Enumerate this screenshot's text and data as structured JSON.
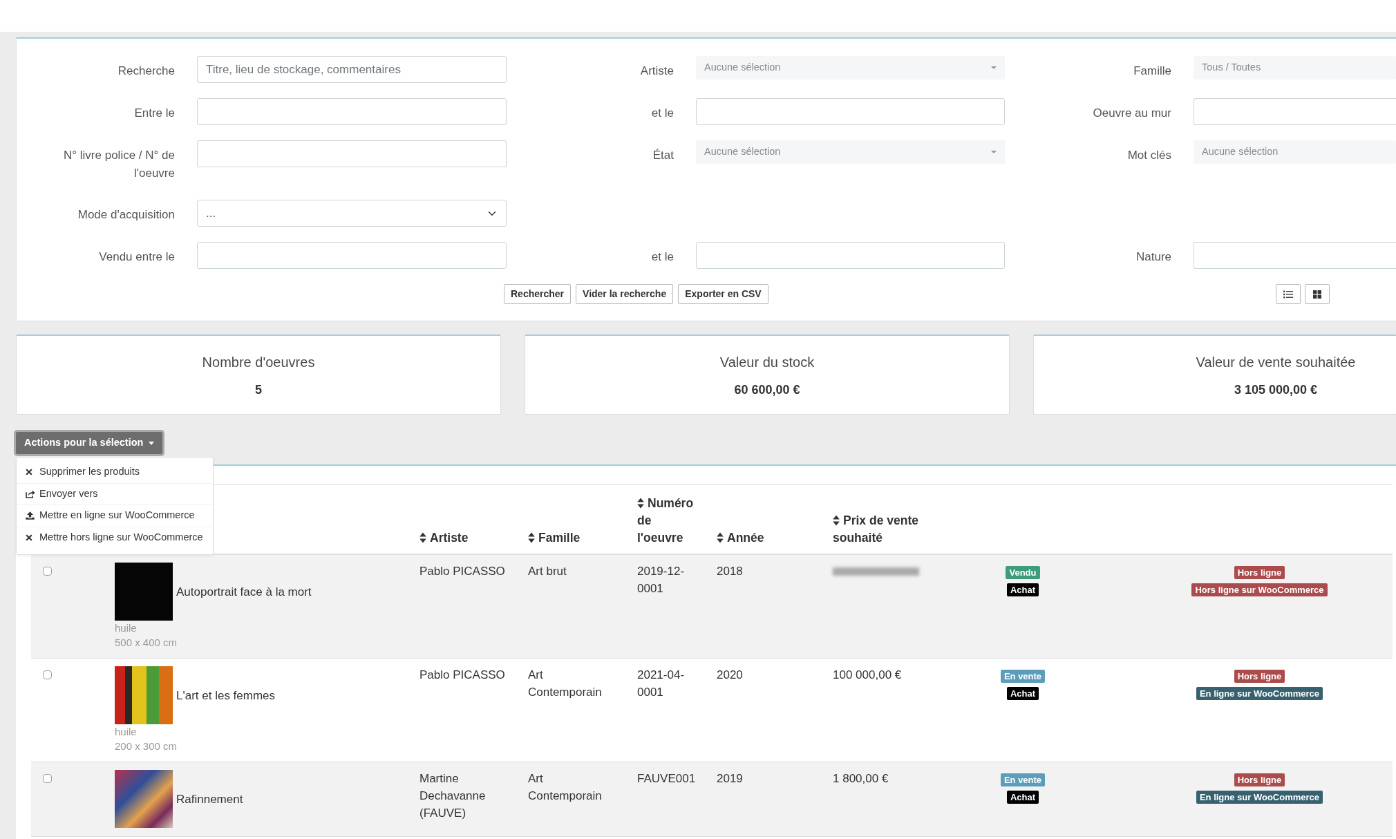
{
  "filters": {
    "rows": [
      [
        {
          "label": "Recherche",
          "kind": "text",
          "placeholder": "Titre, lieu de stockage, commentaires"
        },
        {
          "label": "Artiste",
          "kind": "select",
          "placeholder": "Aucune sélection",
          "caret": true
        },
        {
          "label": "Famille",
          "kind": "select",
          "placeholder": "Tous / Toutes",
          "caret": false
        }
      ],
      [
        {
          "label": "Entre le",
          "kind": "text"
        },
        {
          "label": "et le",
          "kind": "text"
        },
        {
          "label": "Oeuvre au mur",
          "kind": "text"
        }
      ],
      [
        {
          "label": "N° livre police / N° de l'oeuvre",
          "kind": "text"
        },
        {
          "label": "État",
          "kind": "select",
          "placeholder": "Aucune sélection",
          "caret": true
        },
        {
          "label": "Mot clés",
          "kind": "select",
          "placeholder": "Aucune sélection",
          "caret": false
        }
      ],
      [
        {
          "label": "Mode d'acquisition",
          "kind": "dropdown",
          "value": "..."
        },
        null,
        null
      ],
      [
        {
          "label": "Vendu entre le",
          "kind": "text"
        },
        {
          "label": "et le",
          "kind": "text"
        },
        {
          "label": "Nature",
          "kind": "text"
        }
      ]
    ],
    "buttons": [
      "Rechercher",
      "Vider la recherche",
      "Exporter en CSV"
    ],
    "view_buttons": [
      {
        "kind": "list"
      },
      {
        "kind": "grid"
      }
    ]
  },
  "stats": [
    {
      "title": "Nombre d'oeuvres",
      "value": "5"
    },
    {
      "title": "Valeur du stock",
      "value": "60 600,00 €"
    },
    {
      "title": "Valeur de vente souhaitée",
      "value": "3 105 000,00 €"
    }
  ],
  "actions": {
    "label": "Actions pour la sélection",
    "expanded": true,
    "items": [
      {
        "label": "Supprimer les produits",
        "kind": "delete"
      },
      {
        "label": "Envoyer vers",
        "kind": "send"
      },
      {
        "label": "Mettre en ligne sur WooCommerce",
        "kind": "publish"
      },
      {
        "label": "Mettre hors ligne sur WooCommerce",
        "kind": "delete"
      }
    ]
  },
  "table": {
    "columns": [
      {
        "label": "Artiste"
      },
      {
        "label": "Famille"
      },
      {
        "label": "Numéro de l'oeuvre"
      },
      {
        "label": "Année"
      },
      {
        "label": "Prix de vente souhaité"
      }
    ],
    "rows": [
      {
        "checked": false,
        "title": "Autoportrait face à la mort",
        "medium": "huile",
        "size": "500 x 400 cm",
        "artist": "Pablo PICASSO",
        "family": "Art brut",
        "number": "2019-12-0001",
        "year": "2018",
        "price_blurred": true,
        "status_badges": [
          {
            "label": "Vendu",
            "color": "#3d9b7e"
          },
          {
            "label": "Achat",
            "color": "#000000"
          }
        ],
        "shop_badges": [
          {
            "label": "Hors ligne",
            "color": "#ab4b4b"
          },
          {
            "label": "Hors ligne sur WooCommerce",
            "color": "#ab4b4b"
          }
        ]
      },
      {
        "checked": false,
        "title": "L'art et les femmes",
        "medium": "huile",
        "size": "200 x 300 cm",
        "artist": "Pablo PICASSO",
        "family": "Art Contemporain",
        "number": "2021-04-0001",
        "year": "2020",
        "price": "100 000,00 €",
        "price_blurred": false,
        "status_badges": [
          {
            "label": "En vente",
            "color": "#5b9dbb"
          },
          {
            "label": "Achat",
            "color": "#000000"
          }
        ],
        "shop_badges": [
          {
            "label": "Hors ligne",
            "color": "#ab4b4b"
          },
          {
            "label": "En ligne sur WooCommerce",
            "color": "#37616f"
          }
        ]
      },
      {
        "checked": false,
        "title": "Rafinnement",
        "artist": "Martine Dechavanne (FAUVE)",
        "family": "Art Contemporain",
        "number": "FAUVE001",
        "year": "2019",
        "price": "1 800,00 €",
        "price_blurred": false,
        "status_badges": [
          {
            "label": "En vente",
            "color": "#5b9dbb"
          },
          {
            "label": "Achat",
            "color": "#000000"
          }
        ],
        "shop_badges": [
          {
            "label": "Hors ligne",
            "color": "#ab4b4b"
          },
          {
            "label": "En ligne sur WooCommerce",
            "color": "#37616f"
          }
        ]
      }
    ]
  }
}
